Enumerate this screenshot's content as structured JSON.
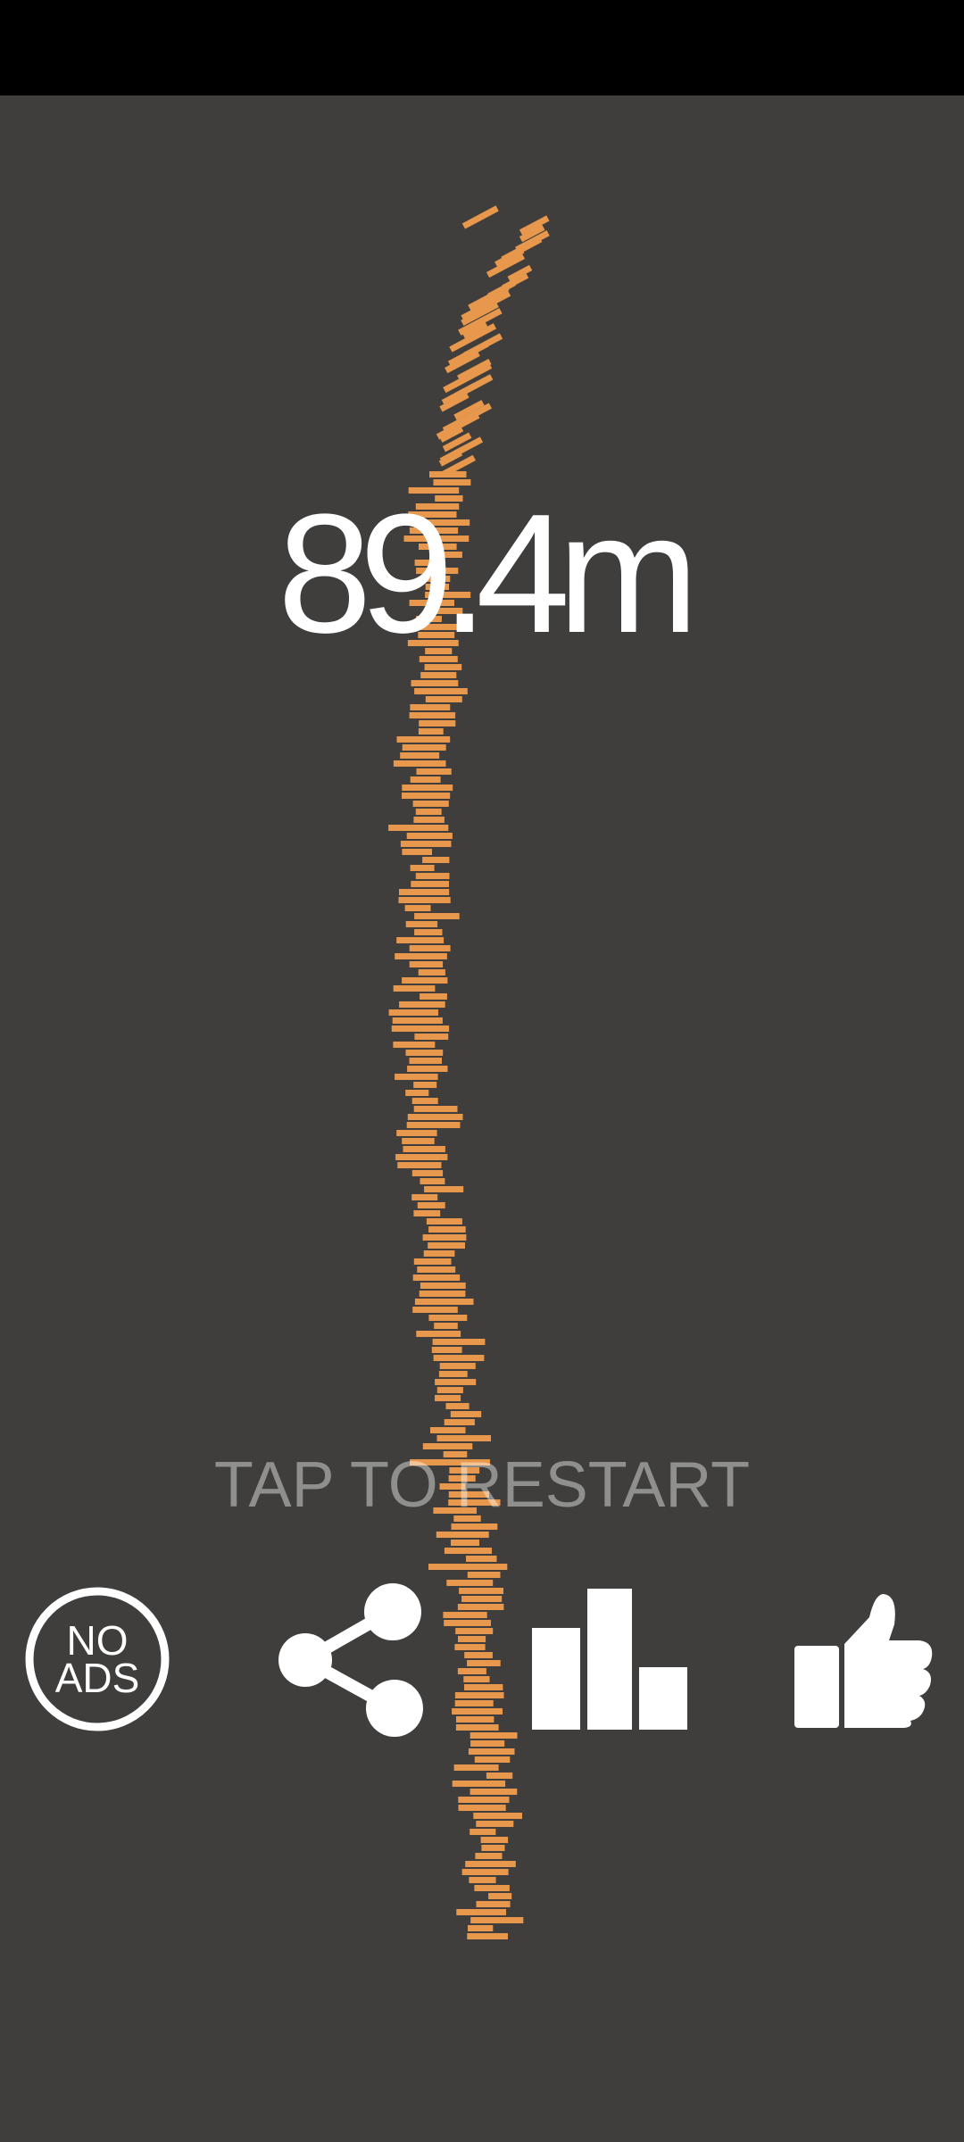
{
  "game": {
    "score_text": "89.4m",
    "restart_text": "TAP TO RESTART"
  },
  "buttons": {
    "no_ads": {
      "icon": "no-ads-icon",
      "line1": "NO",
      "line2": "ADS"
    },
    "share": {
      "icon": "share-icon"
    },
    "leaderboard": {
      "icon": "leaderboard-icon"
    },
    "like": {
      "icon": "thumbs-up-icon"
    }
  },
  "colors": {
    "background": "#3f3e3d",
    "status_bar": "#000000",
    "block": "#e8984c",
    "text": "#ffffff"
  }
}
